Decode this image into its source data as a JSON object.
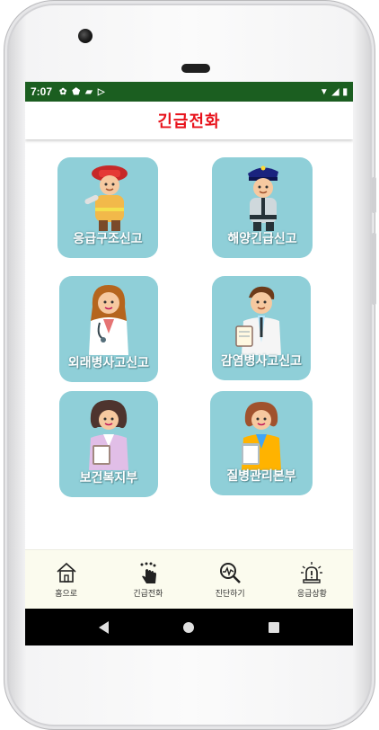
{
  "status_bar": {
    "time": "7:07",
    "left_icons": [
      "gear-icon",
      "shield-icon",
      "sd-card-icon",
      "play-icon"
    ],
    "right_icons": [
      "wifi-icon",
      "signal-icon",
      "battery-icon"
    ]
  },
  "app_bar": {
    "title": "긴급전화",
    "title_color": "#e8121b"
  },
  "cards": [
    {
      "label": "응급구조신고",
      "figure": "firefighter"
    },
    {
      "label": "해양긴급신고",
      "figure": "police-officer"
    },
    {
      "label": "외래병사고신고",
      "figure": "female-doctor"
    },
    {
      "label": "감염병사고신고",
      "figure": "male-doctor"
    },
    {
      "label": "보건복지부",
      "figure": "female-health-worker"
    },
    {
      "label": "질병관리본부",
      "figure": "female-official"
    }
  ],
  "card_color": "#8fcfd8",
  "bottom_nav": [
    {
      "label": "홈으로",
      "icon": "home-icon"
    },
    {
      "label": "긴급전화",
      "icon": "touch-icon"
    },
    {
      "label": "진단하기",
      "icon": "diagnosis-icon"
    },
    {
      "label": "응급상황",
      "icon": "alarm-icon"
    }
  ],
  "system_nav": [
    "back-icon",
    "home-circle-icon",
    "recent-apps-icon"
  ]
}
